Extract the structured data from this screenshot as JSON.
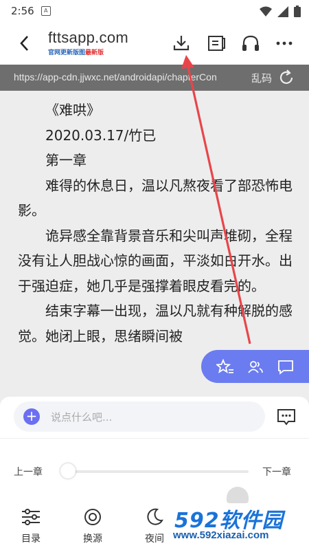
{
  "status_bar": {
    "time": "2:56",
    "badge": "A"
  },
  "header": {
    "site_name": "fttsapp.com",
    "slogan_prefix": "官网更新版图",
    "slogan_highlight": "最新版"
  },
  "url_bar": {
    "url": "https://app-cdn.jjwxc.net/androidapi/chapterCon",
    "encoding_label": "乱码"
  },
  "content": {
    "title": "《难哄》",
    "date_author": "2020.03.17/竹已",
    "chapter": "第一章",
    "paragraphs": [
      "难得的休息日，温以凡熬夜看了部恐怖电影。",
      "诡异感全靠背景音乐和尖叫声堆砌，全程没有让人胆战心惊的画面，平淡如白开水。出于强迫症，她几乎是强撑着眼皮看完的。",
      "结束字幕一出现，温以凡就有种解脱的感觉。她闭上眼，思绪瞬间被"
    ]
  },
  "comment": {
    "placeholder": "说点什么吧..."
  },
  "chapter_nav": {
    "prev": "上一章",
    "next": "下一章",
    "progress": 0
  },
  "bottom_nav": [
    {
      "label": "目录",
      "icon": "sliders-icon"
    },
    {
      "label": "换源",
      "icon": "source-icon"
    },
    {
      "label": "夜间",
      "icon": "moon-icon"
    }
  ],
  "watermark": {
    "big": "592软件园",
    "small": "www.592xiazai.com"
  },
  "colors": {
    "accent": "#6b7cf0",
    "annotation_arrow": "#e8454a",
    "url_bar_bg": "#6e6e6e"
  }
}
